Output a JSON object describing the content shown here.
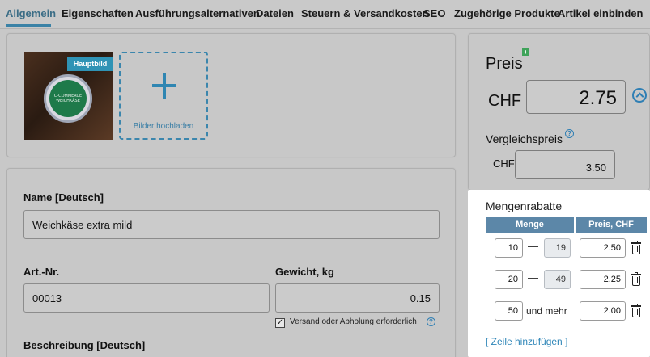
{
  "tabs": [
    {
      "label": "Allgemein",
      "active": true
    },
    {
      "label": "Eigenschaften"
    },
    {
      "label": "Ausführungsalternativen"
    },
    {
      "label": "Dateien"
    },
    {
      "label": "Steuern & Versandkosten"
    },
    {
      "label": "SEO"
    },
    {
      "label": "Zugehörige Produkte"
    },
    {
      "label": "Artikel einbinden"
    }
  ],
  "images": {
    "main_badge": "Hauptbild",
    "product_label": "C-COMMERCE\nWEICHKÄSE",
    "upload_label": "Bilder hochladen"
  },
  "details": {
    "name_label": "Name [Deutsch]",
    "name_value": "Weichkäse extra mild",
    "artnr_label": "Art.-Nr.",
    "artnr_value": "00013",
    "weight_label": "Gewicht, kg",
    "weight_value": "0.15",
    "shipping_checkbox_label": "Versand oder Abholung erforderlich",
    "shipping_checked": true,
    "description_label": "Beschreibung [Deutsch]"
  },
  "price": {
    "title": "Preis",
    "currency": "CHF",
    "value": "2.75",
    "compare_label": "Vergleichspreis",
    "compare_currency": "CHF",
    "compare_value": "3.50"
  },
  "quantity_discounts": {
    "title": "Mengenrabatte",
    "col_quantity": "Menge",
    "col_price": "Preis, CHF",
    "rows": [
      {
        "from": "10",
        "to": "19",
        "price": "2.50"
      },
      {
        "from": "20",
        "to": "49",
        "price": "2.25"
      },
      {
        "from": "50",
        "to_text": "und mehr",
        "price": "2.00"
      }
    ],
    "dash": "—",
    "add_row": "[ Zeile hinzufügen ]"
  },
  "colors": {
    "accent": "#2f86b8",
    "table_header": "#5c87a8",
    "badge": "#2f93b5"
  }
}
